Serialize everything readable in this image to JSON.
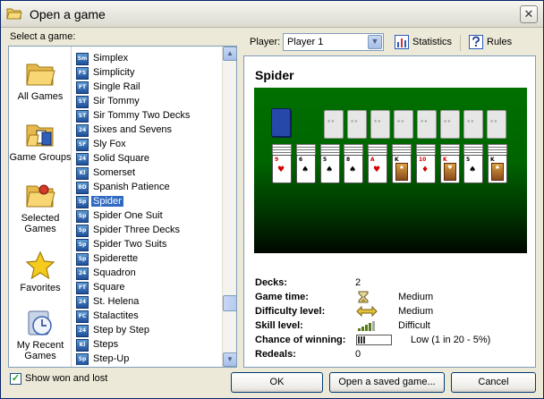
{
  "window": {
    "title": "Open a game",
    "close_glyph": "✕"
  },
  "select_label": "Select a game:",
  "groups": [
    {
      "label": "All Games",
      "icon": "folder-icon"
    },
    {
      "label": "Game Groups",
      "icon": "game-groups-icon"
    },
    {
      "label": "Selected Games",
      "icon": "selected-games-icon"
    },
    {
      "label": "Favorites",
      "icon": "star-icon"
    },
    {
      "label": "My Recent Games",
      "icon": "recent-games-icon"
    }
  ],
  "games": [
    {
      "abbr": "Sm",
      "name": "Simplex"
    },
    {
      "abbr": "FS",
      "name": "Simplicity"
    },
    {
      "abbr": "FT",
      "name": "Single Rail"
    },
    {
      "abbr": "ST",
      "name": "Sir Tommy"
    },
    {
      "abbr": "ST",
      "name": "Sir Tommy Two Decks"
    },
    {
      "abbr": "24",
      "name": "Sixes and Sevens"
    },
    {
      "abbr": "SF",
      "name": "Sly Fox"
    },
    {
      "abbr": "24",
      "name": "Solid Square"
    },
    {
      "abbr": "Kl",
      "name": "Somerset"
    },
    {
      "abbr": "BD",
      "name": "Spanish Patience"
    },
    {
      "abbr": "Sp",
      "name": "Spider",
      "selected": true
    },
    {
      "abbr": "Sp",
      "name": "Spider One Suit"
    },
    {
      "abbr": "Sp",
      "name": "Spider Three Decks"
    },
    {
      "abbr": "Sp",
      "name": "Spider Two Suits"
    },
    {
      "abbr": "Sp",
      "name": "Spiderette"
    },
    {
      "abbr": "24",
      "name": "Squadron"
    },
    {
      "abbr": "FT",
      "name": "Square"
    },
    {
      "abbr": "24",
      "name": "St. Helena"
    },
    {
      "abbr": "FC",
      "name": "Stalactites"
    },
    {
      "abbr": "24",
      "name": "Step by Step"
    },
    {
      "abbr": "Kl",
      "name": "Steps"
    },
    {
      "abbr": "Sp",
      "name": "Step-Up"
    }
  ],
  "scrollbar": {
    "up_glyph": "▲",
    "down_glyph": "▼"
  },
  "toolbar": {
    "player_label": "Player:",
    "player_value": "Player 1",
    "player_drop_glyph": "▼",
    "statistics_label": "Statistics",
    "rules_label": "Rules"
  },
  "details": {
    "title": "Spider",
    "info": [
      {
        "label": "Decks:",
        "value": "2"
      },
      {
        "label": "Game time:",
        "value": "Medium",
        "icon": "hourglass-icon"
      },
      {
        "label": "Difficulty level:",
        "value": "Medium",
        "icon": "double-arrow-icon"
      },
      {
        "label": "Skill level:",
        "value": "Difficult",
        "icon": "skill-bars-icon"
      },
      {
        "label": "Chance of winning:",
        "value": "Low  (1 in 20  -  5%)",
        "icon": "chance-meter-icon"
      },
      {
        "label": "Redeals:",
        "value": "0"
      }
    ]
  },
  "preview": {
    "tableau": [
      {
        "rank": "9",
        "suit": "♥",
        "color": "red"
      },
      {
        "rank": "6",
        "suit": "♠",
        "color": "blk"
      },
      {
        "rank": "5",
        "suit": "♠",
        "color": "blk"
      },
      {
        "rank": "8",
        "suit": "♠",
        "color": "blk"
      },
      {
        "rank": "A",
        "suit": "♥",
        "color": "red"
      },
      {
        "rank": "K",
        "suit": "♠",
        "color": "blk",
        "royal": true
      },
      {
        "rank": "10",
        "suit": "♦",
        "color": "red"
      },
      {
        "rank": "K",
        "suit": "♥",
        "color": "red",
        "royal": true
      },
      {
        "rank": "5",
        "suit": "♠",
        "color": "blk"
      },
      {
        "rank": "K",
        "suit": "♣",
        "color": "blk",
        "royal": true
      }
    ]
  },
  "footer": {
    "show_won_label": "Show won and lost",
    "show_won_checked": "✓",
    "ok_label": "OK",
    "open_saved_label": "Open a saved game...",
    "cancel_label": "Cancel"
  },
  "colors": {
    "selection": "#316ac5",
    "felt": "#006400",
    "window_bg": "#ece9d8"
  }
}
